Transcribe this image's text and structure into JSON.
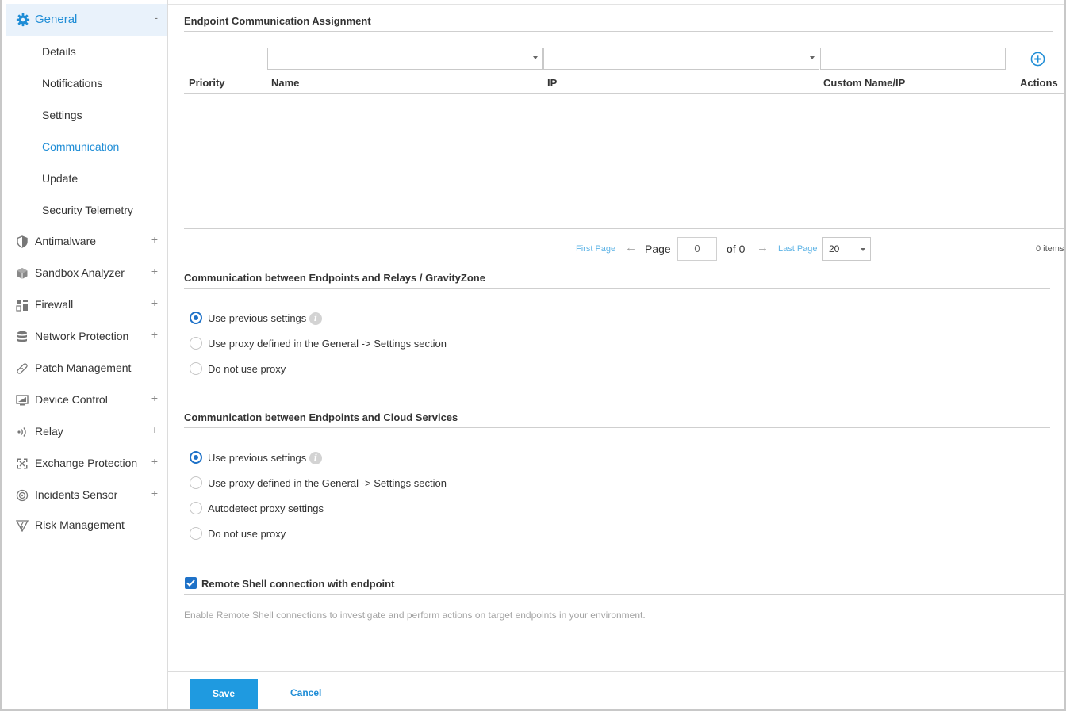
{
  "sidebar": {
    "general": {
      "label": "General",
      "toggle": "-"
    },
    "sub_items": [
      {
        "label": "Details",
        "active": false
      },
      {
        "label": "Notifications",
        "active": false
      },
      {
        "label": "Settings",
        "active": false
      },
      {
        "label": "Communication",
        "active": true
      },
      {
        "label": "Update",
        "active": false
      },
      {
        "label": "Security Telemetry",
        "active": false
      }
    ],
    "items": [
      {
        "label": "Antimalware",
        "toggle": "+",
        "icon": "shield-icon"
      },
      {
        "label": "Sandbox Analyzer",
        "toggle": "+",
        "icon": "cube-icon"
      },
      {
        "label": "Firewall",
        "toggle": "+",
        "icon": "firewall-icon"
      },
      {
        "label": "Network Protection",
        "toggle": "+",
        "icon": "database-icon"
      },
      {
        "label": "Patch Management",
        "toggle": "",
        "icon": "bandage-icon"
      },
      {
        "label": "Device Control",
        "toggle": "+",
        "icon": "monitor-icon"
      },
      {
        "label": "Relay",
        "toggle": "+",
        "icon": "broadcast-icon"
      },
      {
        "label": "Exchange Protection",
        "toggle": "+",
        "icon": "exchange-icon"
      },
      {
        "label": "Incidents Sensor",
        "toggle": "+",
        "icon": "sensor-icon"
      },
      {
        "label": "Risk Management",
        "toggle": "",
        "icon": "risk-icon"
      }
    ]
  },
  "assignment": {
    "title": "Endpoint Communication Assignment",
    "name_select": "",
    "ip_select": "",
    "custom_input": "",
    "columns": {
      "priority": "Priority",
      "name": "Name",
      "ip": "IP",
      "custom": "Custom Name/IP",
      "actions": "Actions"
    },
    "pager": {
      "first": "First Page",
      "page_label": "Page",
      "page_value": "0",
      "of_label": "of 0",
      "last": "Last Page",
      "per_page": "20",
      "items": "0 items"
    }
  },
  "relays_section": {
    "title": "Communication between Endpoints and Relays / GravityZone",
    "options": [
      {
        "label": "Use previous settings",
        "selected": true,
        "info": true
      },
      {
        "label": "Use proxy defined in the General -> Settings section",
        "selected": false,
        "info": false
      },
      {
        "label": "Do not use proxy",
        "selected": false,
        "info": false
      }
    ]
  },
  "cloud_section": {
    "title": "Communication between Endpoints and Cloud Services",
    "options": [
      {
        "label": "Use previous settings",
        "selected": true,
        "info": true
      },
      {
        "label": "Use proxy defined in the General -> Settings section",
        "selected": false,
        "info": false
      },
      {
        "label": "Autodetect proxy settings",
        "selected": false,
        "info": false
      },
      {
        "label": "Do not use proxy",
        "selected": false,
        "info": false
      }
    ]
  },
  "remote_shell": {
    "label": "Remote Shell connection with endpoint",
    "checked": true,
    "description": "Enable Remote Shell connections to investigate and perform actions on target endpoints in your environment."
  },
  "footer": {
    "save": "Save",
    "cancel": "Cancel"
  },
  "colors": {
    "accent": "#1f8dd6",
    "primary_button": "#1f9ae0",
    "active_bg": "#e9f2fb"
  }
}
